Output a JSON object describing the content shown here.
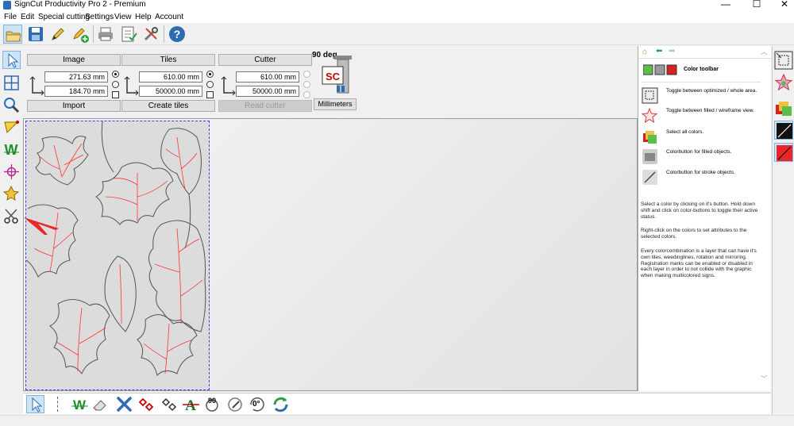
{
  "window": {
    "title": "SignCut Productivity Pro 2 - Premium",
    "min": "—",
    "max": "☐",
    "close": "✕"
  },
  "menu": [
    "File",
    "Edit",
    "Special cutting",
    "Settings",
    "View",
    "Help",
    "Account"
  ],
  "image_panel": {
    "header": "Image",
    "width": "271.63 mm",
    "height": "184.70 mm",
    "button": "Import"
  },
  "tiles_panel": {
    "header": "Tiles",
    "width": "610.00 mm",
    "height": "50000.00 mm",
    "button": "Create tiles"
  },
  "cutter_panel": {
    "header": "Cutter",
    "width": "610.00 mm",
    "height": "50000.00 mm",
    "button": "Read cutter"
  },
  "rotation": {
    "label": "90 deg",
    "logo": "SC",
    "units_button": "Millimeters"
  },
  "help": {
    "title": "Color toolbar",
    "rows": [
      "Toggle between optimized / whole area.",
      "Toggle between filled / wireframe view.",
      "Select all colors.",
      "Colorbutton for filled objects.",
      "Colorbutton for stroke objects."
    ],
    "para1": "Select a color by clicking on it's button. Hold down shift and click on color-buttons to toggle their active status.",
    "para2": "Right-click on the colors to set attributes to the selected colors.",
    "para3": "Every colorcombination is a layer that can have it's own tiles, weedinglines, rotation and mirroring. Registration marks can be enabled or disabled in each layer in order to not collide with the graphic when making multicolored signs."
  },
  "bottom_tools": {
    "rotate90": "90",
    "rotate0": "0°"
  },
  "colors": {
    "accent_red": "#e8262b",
    "leaf_stroke": "#555555",
    "vein": "#ff3333",
    "selection_blue": "#3a3af0"
  }
}
